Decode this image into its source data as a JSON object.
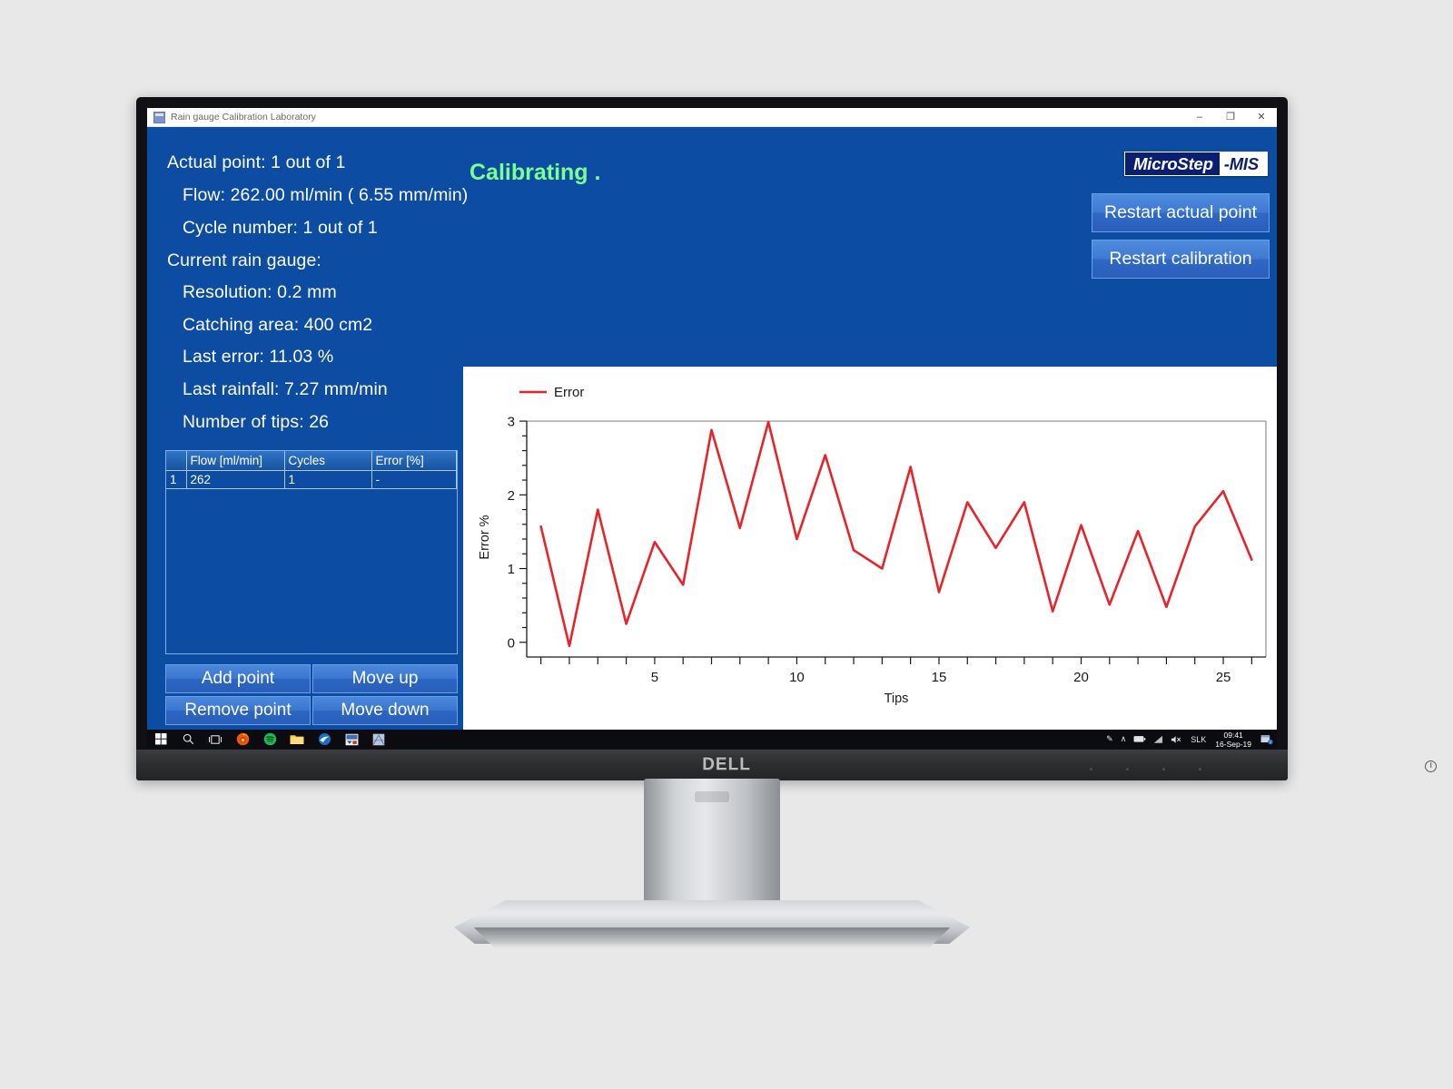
{
  "window": {
    "title": "Rain gauge Calibration Laboratory",
    "minimize_label": "–",
    "maximize_label": "❐",
    "close_label": "✕"
  },
  "info": {
    "actual_point": "Actual point: 1 out of 1",
    "flow": "Flow: 262.00 ml/min ( 6.55 mm/min)",
    "cycle_number": "Cycle number: 1 out of 1",
    "current_gauge": "Current rain gauge:",
    "resolution": "Resolution: 0.2  mm",
    "catching_area": "Catching area: 400  cm2",
    "last_error": "Last error: 11.03 %",
    "last_rainfall": "Last rainfall: 7.27 mm/min",
    "number_of_tips": "Number of tips: 26"
  },
  "status": {
    "text": "Calibrating .",
    "color": "#7bff8e"
  },
  "logo": {
    "left": "MicroStep",
    "right": "-MIS"
  },
  "buttons": {
    "restart_actual_point": "Restart actual point",
    "restart_calibration": "Restart calibration",
    "add_point": "Add point",
    "move_up": "Move up",
    "remove_point": "Remove point",
    "move_down": "Move down"
  },
  "table": {
    "headers": [
      "",
      "Flow [ml/min]",
      "Cycles",
      "Error [%]"
    ],
    "rows": [
      {
        "index": "1",
        "flow": "262",
        "cycles": "1",
        "error": "-"
      }
    ]
  },
  "chart_data": {
    "type": "line",
    "title": "",
    "xlabel": "Tips",
    "ylabel": "Error %",
    "legend": [
      "Error"
    ],
    "legend_position": "top-left",
    "series_color": "#e8232a",
    "grid": false,
    "xlim": [
      0.5,
      26.5
    ],
    "ylim": [
      -0.2,
      3.05
    ],
    "xticks": [
      5,
      10,
      15,
      20,
      25
    ],
    "yticks": [
      0,
      1,
      2,
      3
    ],
    "x": [
      1,
      2,
      3,
      4,
      5,
      6,
      7,
      8,
      9,
      10,
      11,
      12,
      13,
      14,
      15,
      16,
      17,
      18,
      19,
      20,
      21,
      22,
      23,
      24,
      25,
      26
    ],
    "series": [
      {
        "name": "Error",
        "values": [
          1.57,
          -0.05,
          1.8,
          0.25,
          1.36,
          0.78,
          2.88,
          1.55,
          2.99,
          1.4,
          2.54,
          1.25,
          1.0,
          2.38,
          0.68,
          1.9,
          1.28,
          1.9,
          0.42,
          1.59,
          0.51,
          1.51,
          0.48,
          1.57,
          2.05,
          1.12
        ]
      }
    ]
  },
  "taskbar": {
    "icons": [
      "windows-start-icon",
      "search-icon",
      "task-view-icon",
      "firefox-icon",
      "spotify-icon",
      "file-explorer-icon",
      "mail-icon",
      "visio-icon",
      "app-icon"
    ],
    "tray": {
      "pen_label": "✎",
      "chevron_label": "∧",
      "battery_label": "▭",
      "network_label": "◢",
      "volume_label": "⏵×",
      "language": "SLK",
      "time": "09:41",
      "date": "16-Sep-19",
      "notification_label": "▤"
    }
  },
  "monitor": {
    "brand": "DELL"
  }
}
